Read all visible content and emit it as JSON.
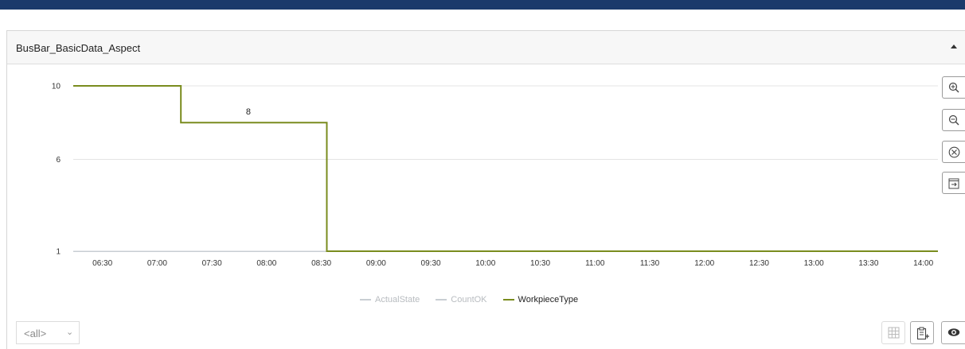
{
  "header": {
    "title": "BusBar_BasicData_Aspect"
  },
  "chart_data": {
    "type": "line",
    "y_ticks": [
      "10",
      "6",
      "1"
    ],
    "x_ticks": [
      "06:30",
      "07:00",
      "07:30",
      "08:00",
      "08:30",
      "09:00",
      "09:30",
      "10:00",
      "10:30",
      "11:00",
      "11:30",
      "12:00",
      "12:30",
      "13:00",
      "13:30",
      "14:00"
    ],
    "x_range": [
      "06:14",
      "14:08"
    ],
    "y_range": [
      1,
      10
    ],
    "grid": true,
    "annotations": [
      {
        "text": "8",
        "x": "07:50",
        "y": 8
      }
    ],
    "series": [
      {
        "name": "WorkpieceType",
        "color": "#7a8c1e",
        "step": true,
        "points": [
          {
            "x": "06:14",
            "y": 10
          },
          {
            "x": "07:13",
            "y": 10
          },
          {
            "x": "07:13",
            "y": 8
          },
          {
            "x": "08:33",
            "y": 8
          },
          {
            "x": "08:33",
            "y": 1
          },
          {
            "x": "14:08",
            "y": 1
          }
        ]
      },
      {
        "name": "CountOK",
        "color": "#c9ced3",
        "hidden": true,
        "points": [
          {
            "x": "06:14",
            "y": 1
          },
          {
            "x": "14:08",
            "y": 1
          }
        ]
      },
      {
        "name": "ActualState",
        "color": "#c9ced3",
        "hidden": true,
        "points": [
          {
            "x": "06:14",
            "y": 1
          },
          {
            "x": "14:08",
            "y": 1
          }
        ]
      }
    ],
    "legend_position": "bottom-center"
  },
  "legend": [
    {
      "label": "ActualState",
      "color": "#c9ced3",
      "active": false
    },
    {
      "label": "CountOK",
      "color": "#c9ced3",
      "active": false
    },
    {
      "label": "WorkpieceType",
      "color": "#7a8c1e",
      "active": true
    }
  ],
  "toolbar": {
    "zoom_in_icon": "zoom-in-icon",
    "zoom_out_icon": "zoom-out-icon",
    "reset_icon": "reset-zoom-icon",
    "export_icon": "export-icon"
  },
  "filter": {
    "value": "<all>"
  },
  "footer_icons": [
    "table-icon",
    "clipboard-add-icon",
    "eye-icon"
  ]
}
